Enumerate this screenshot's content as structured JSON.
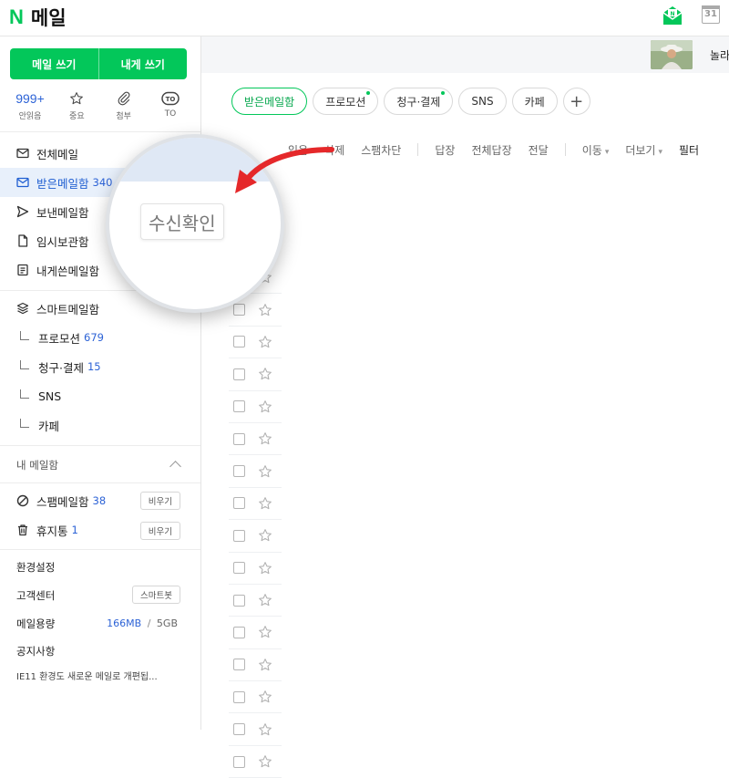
{
  "header": {
    "logo_letter": "N",
    "title": "메일",
    "calendar_day": "31"
  },
  "sidebar": {
    "write_mail": "메일 쓰기",
    "write_self": "내게 쓰기",
    "quick": [
      {
        "count": "999+",
        "label": "안읽음"
      },
      {
        "label": "중요"
      },
      {
        "label": "첨부"
      },
      {
        "label": "TO"
      }
    ],
    "folders": [
      {
        "label": "전체메일"
      },
      {
        "label": "받은메일함",
        "count": "340"
      },
      {
        "label": "보낸메일함"
      },
      {
        "label": "임시보관함"
      },
      {
        "label": "내게쓴메일함"
      }
    ],
    "smart": {
      "label": "스마트메일함",
      "items": [
        {
          "label": "프로모션",
          "count": "679"
        },
        {
          "label": "청구·결제",
          "count": "15"
        },
        {
          "label": "SNS"
        },
        {
          "label": "카페"
        }
      ]
    },
    "my_mailbox_title": "내 메일함",
    "spam": {
      "label": "스팸메일함",
      "count": "38",
      "button": "비우기"
    },
    "trash": {
      "label": "휴지통",
      "count": "1",
      "button": "비우기"
    },
    "settings": "환경설정",
    "support": "고객센터",
    "smartbot": "스마트봇",
    "usage_label": "메일용량",
    "usage_used": "166MB",
    "usage_sep": "/",
    "usage_total": "5GB",
    "notice_title": "공지사항",
    "notice_text": "IE11 환경도 새로운 메일로 개편됩..."
  },
  "main": {
    "user_name": "놀라",
    "tabs": [
      {
        "label": "받은메일함",
        "active": true
      },
      {
        "label": "프로모션",
        "dot": true
      },
      {
        "label": "청구·결제",
        "dot": true
      },
      {
        "label": "SNS"
      },
      {
        "label": "카페"
      }
    ],
    "add_tab": "+",
    "toolbar": {
      "read": "읽음",
      "delete": "삭제",
      "block_spam": "스팸차단",
      "reply": "답장",
      "reply_all": "전체답장",
      "forward": "전달",
      "move": "이동",
      "more": "더보기",
      "filter": "필터"
    }
  },
  "magnifier": {
    "button_label": "수신확인"
  },
  "colors": {
    "accent": "#03c75a",
    "link": "#2d63d6",
    "active_bg": "#e8f0fb",
    "arrow": "#e5282a"
  }
}
